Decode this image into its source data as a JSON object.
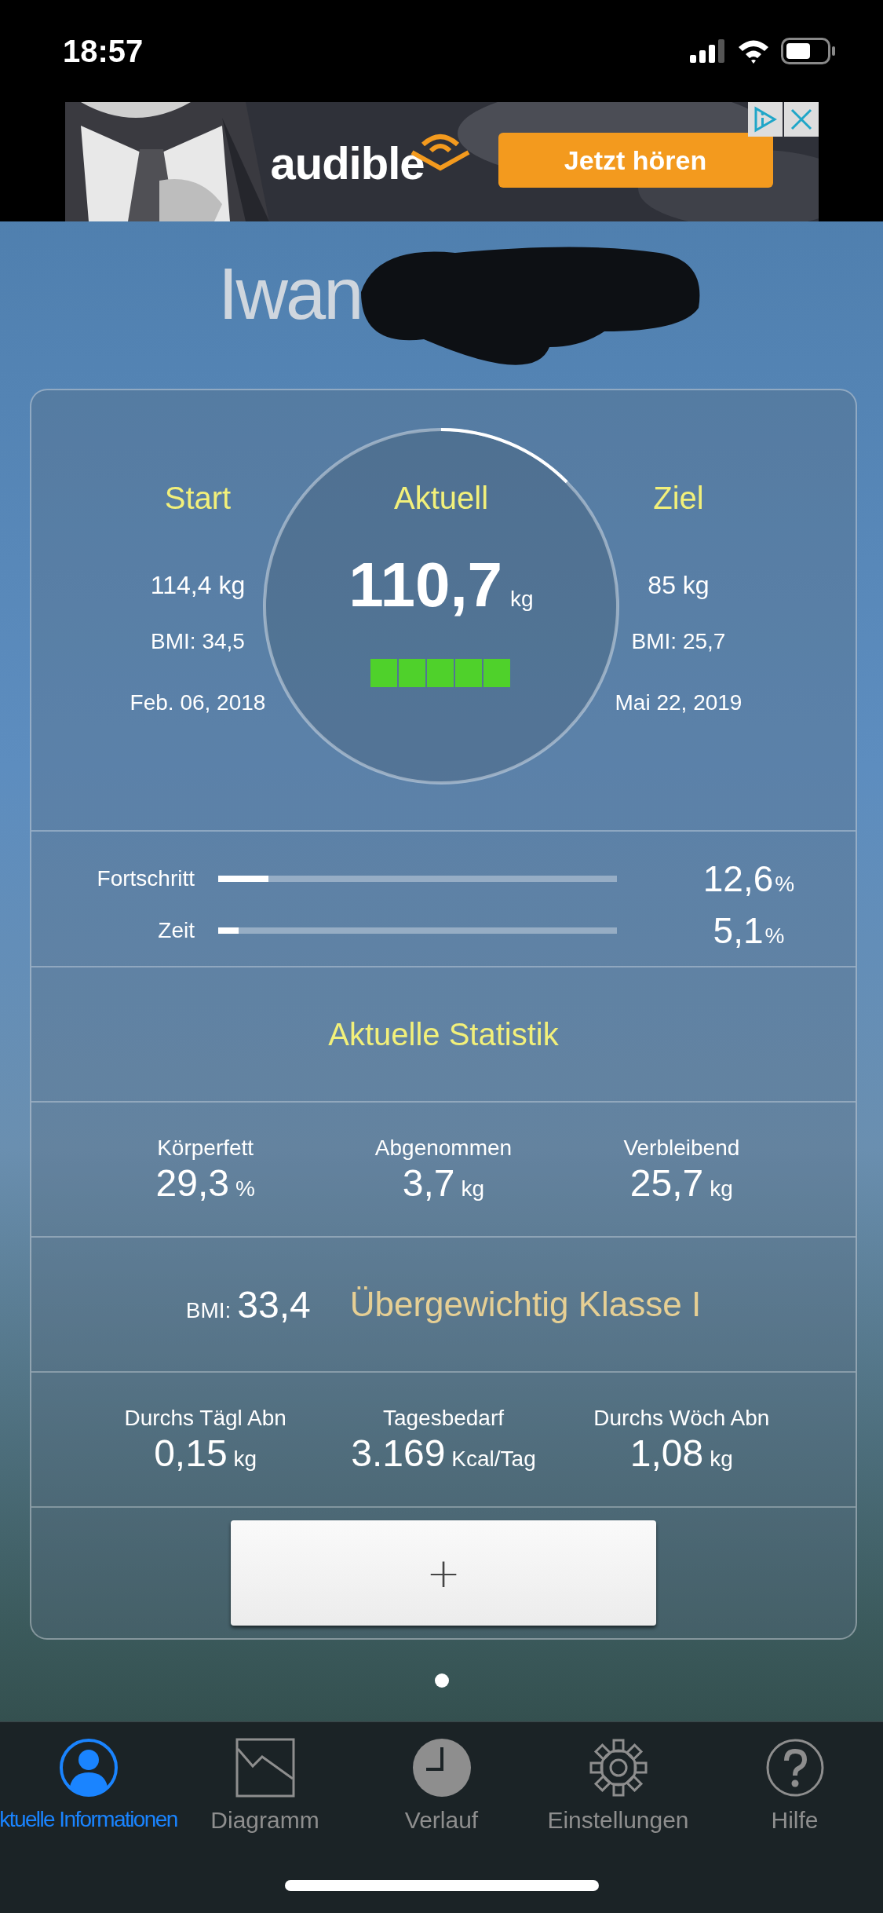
{
  "status_bar": {
    "time": "18:57"
  },
  "ad": {
    "brand": "audible",
    "button": "Jetzt hören"
  },
  "profile": {
    "name": "Iwan"
  },
  "summary": {
    "start": {
      "title": "Start",
      "weight": "114,4 kg",
      "bmi": "BMI: 34,5",
      "date": "Feb. 06, 2018"
    },
    "current": {
      "title": "Aktuell",
      "value": "110,7",
      "unit": "kg",
      "level": 0.126
    },
    "goal": {
      "title": "Ziel",
      "weight": "85 kg",
      "bmi": "BMI: 25,7",
      "date": "Mai 22, 2019"
    }
  },
  "progress": [
    {
      "label": "Fortschritt",
      "level": 0.126,
      "value": "12,6",
      "unit": "%"
    },
    {
      "label": "Zeit",
      "level": 0.051,
      "value": "5,1",
      "unit": "%"
    }
  ],
  "statistics_title": "Aktuelle Statistik",
  "sections": [
    {
      "kind": "stats",
      "items": [
        {
          "label": "Körperfett",
          "value": "29,3",
          "unit": "%"
        },
        {
          "label": "Abgenommen",
          "value": "3,7",
          "unit": "kg"
        },
        {
          "label": "Verbleibend",
          "value": "25,7",
          "unit": "kg"
        }
      ]
    },
    {
      "kind": "bmi",
      "label": "BMI:",
      "value": "33,4",
      "category": "Übergewichtig Klasse I"
    },
    {
      "kind": "stats",
      "items": [
        {
          "label": "Durchs Tägl Abn",
          "value": "0,15",
          "unit": "kg"
        },
        {
          "label": "Tagesbedarf",
          "value": "3.169",
          "unit": "Kcal/Tag"
        },
        {
          "label": "Durchs Wöch Abn",
          "value": "1,08",
          "unit": "kg"
        }
      ]
    }
  ],
  "add_button": {
    "label": "+"
  },
  "page_dots": [
    {
      "selected": true
    }
  ],
  "tabs": [
    {
      "label": "ktuelle Informationen",
      "kind": "person",
      "selected": true
    },
    {
      "label": "Diagramm",
      "kind": "chart",
      "selected": false
    },
    {
      "label": "Verlauf",
      "kind": "clock",
      "selected": false
    },
    {
      "label": "Einstellungen",
      "kind": "gear",
      "selected": false
    },
    {
      "label": "Hilfe",
      "kind": "help",
      "selected": false
    }
  ]
}
